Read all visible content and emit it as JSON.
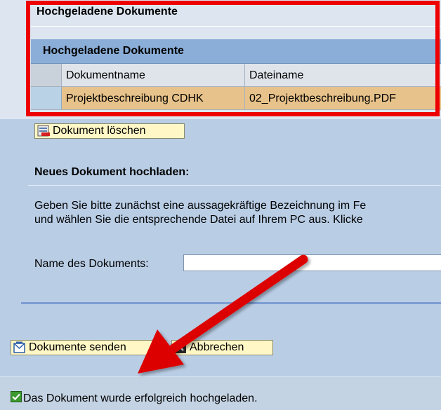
{
  "uploaded_section": {
    "title": "Hochgeladene Dokumente",
    "table": {
      "title": "Hochgeladene Dokumente",
      "columns": [
        "Dokumentname",
        "Dateiname"
      ],
      "rows": [
        {
          "name": "Projektbeschreibung CDHK",
          "file": "02_Projektbeschreibung.PDF"
        }
      ]
    }
  },
  "buttons": {
    "delete": "Dokument löschen",
    "send": "Dokumente senden",
    "cancel": "Abbrechen"
  },
  "new_upload": {
    "title": "Neues Dokument hochladen:",
    "intro_line1": "Geben Sie bitte zunächst eine aussagekräftige Bezeichnung im Fe",
    "intro_line2": "und wählen Sie die entsprechende Datei auf Ihrem PC aus. Klicke",
    "name_label": "Name des Dokuments:",
    "name_value": ""
  },
  "status": {
    "message": "Das Dokument wurde erfolgreich hochgeladen.",
    "icon": "success-check-icon"
  },
  "colors": {
    "highlight_border": "#ee0000",
    "arrow": "#dd0000",
    "selected_row": "#e7c28a",
    "table_header": "#8aaed8",
    "button_bg": "#fff7c6"
  }
}
